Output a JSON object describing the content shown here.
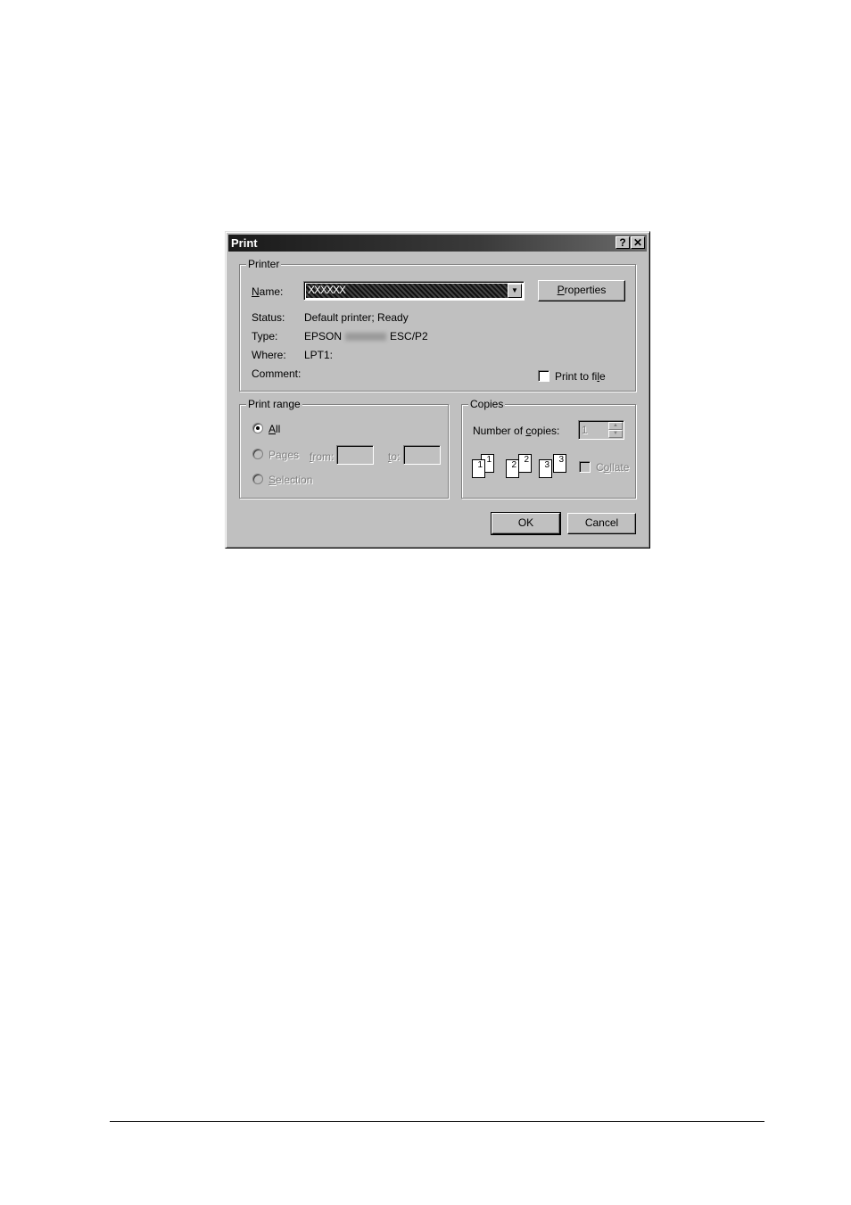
{
  "dialog": {
    "title": "Print",
    "help_button": "?",
    "close_button": "✕"
  },
  "printer_group": {
    "label": "Printer",
    "name_label_u": "N",
    "name_label_rest": "ame:",
    "name_value": "XXXXXX",
    "properties_button_u": "P",
    "properties_button_rest": "roperties",
    "status_label": "Status:",
    "status_value": "Default printer; Ready",
    "type_label": "Type:",
    "type_value_prefix": "EPSON",
    "type_value_suffix": "ESC/P2",
    "where_label": "Where:",
    "where_value": "LPT1:",
    "comment_label": "Comment:",
    "print_to_file_pre": "Print to fi",
    "print_to_file_u": "l",
    "print_to_file_post": "e"
  },
  "print_range": {
    "label": "Print range",
    "all_u": "A",
    "all_rest": "ll",
    "pages_label": "Pages",
    "from_label_u": "f",
    "from_label_rest": "rom:",
    "to_label_u": "t",
    "to_label_rest": "o:",
    "selection_u": "S",
    "selection_rest": "election"
  },
  "copies": {
    "label": "Copies",
    "number_label_pre": "Number of ",
    "number_label_u": "c",
    "number_label_post": "opies:",
    "number_value": "1",
    "collate_pre": "C",
    "collate_u": "o",
    "collate_post": "llate",
    "page_numbers": [
      "1",
      "1",
      "2",
      "2",
      "3",
      "3"
    ]
  },
  "buttons": {
    "ok": "OK",
    "cancel": "Cancel"
  }
}
